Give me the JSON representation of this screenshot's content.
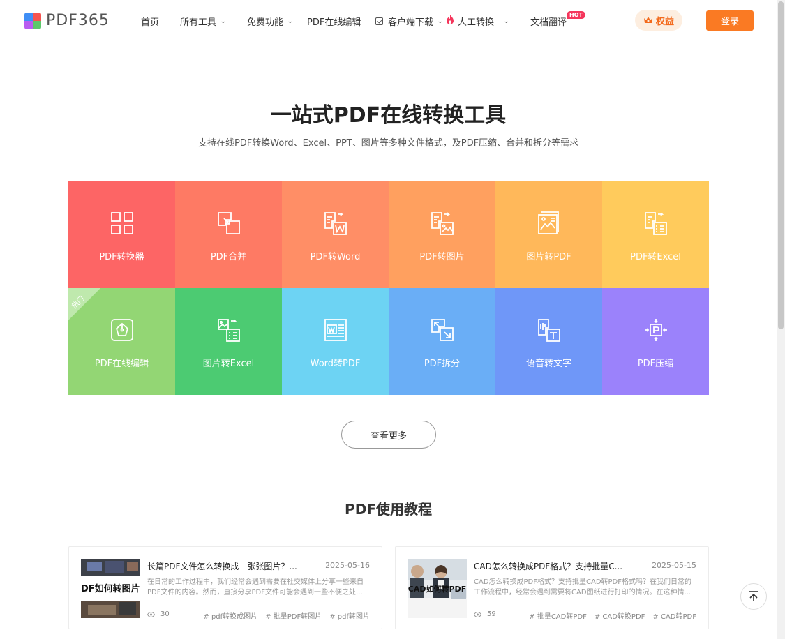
{
  "logo": {
    "text": "PDF365"
  },
  "nav": {
    "home": "首页",
    "all_tools": "所有工具",
    "free_features": "免费功能",
    "online_edit": "PDF在线编辑",
    "client_download": "客户端下载",
    "manual_convert": "人工转换",
    "doc_translate": "文档翻译",
    "hot_badge": "HOT"
  },
  "header": {
    "benefits": "权益",
    "login": "登录"
  },
  "hero": {
    "title": "一站式PDF在线转换工具",
    "subtitle": "支持在线PDF转换Word、Excel、PPT、图片等多种文件格式，及PDF压缩、合并和拆分等需求"
  },
  "tools": [
    {
      "label": "PDF转换器",
      "color": "#fd6565",
      "icon": "grid-icon"
    },
    {
      "label": "PDF合并",
      "color": "#fe7a64",
      "icon": "merge-icon"
    },
    {
      "label": "PDF转Word",
      "color": "#ff8e66",
      "icon": "pdf-to-word-icon"
    },
    {
      "label": "PDF转图片",
      "color": "#ffa05f",
      "icon": "pdf-to-image-icon"
    },
    {
      "label": "图片转PDF",
      "color": "#ffb85a",
      "icon": "image-to-pdf-icon"
    },
    {
      "label": "PDF转Excel",
      "color": "#ffcb5c",
      "icon": "pdf-to-excel-icon"
    },
    {
      "label": "PDF在线编辑",
      "color": "#93d674",
      "icon": "edit-icon",
      "badge": "热门"
    },
    {
      "label": "图片转Excel",
      "color": "#4ccb72",
      "icon": "image-to-excel-icon"
    },
    {
      "label": "Word转PDF",
      "color": "#6dd3f3",
      "icon": "word-to-pdf-icon"
    },
    {
      "label": "PDF拆分",
      "color": "#6aaef6",
      "icon": "split-icon"
    },
    {
      "label": "语音转文字",
      "color": "#6f97f8",
      "icon": "speech-to-text-icon"
    },
    {
      "label": "PDF压缩",
      "color": "#9b82fb",
      "icon": "compress-icon"
    }
  ],
  "more_button": "查看更多",
  "tutorials": {
    "title": "PDF使用教程",
    "articles": [
      {
        "title": "长篇PDF文件怎么转换成一张张图片？...",
        "date": "2025-05-16",
        "desc": "在日常的工作过程中，我们经常会遇到需要在社交媒体上分享一些来自PDF文件的内容。然而，直接分享PDF文件可能会遇到一些不便之处...",
        "views": "30",
        "tags": [
          "# pdf转换成图片",
          "# 批量PDF转图片",
          "# pdf转图片"
        ],
        "thumb_text": "DF如何转图片"
      },
      {
        "title": "CAD怎么转换成PDF格式？支持批量C...",
        "date": "2025-05-15",
        "desc": "CAD怎么转换成PDF格式？支持批量CAD转PDF格式吗？在我们日常的工作流程中，经常会遇到需要将CAD图纸进行打印的情况。在这种情...",
        "views": "59",
        "tags": [
          "# 批量CAD转PDF",
          "# CAD转换PDF",
          "# CAD转PDF"
        ],
        "thumb_text": "CAD如何转PDF"
      }
    ]
  }
}
